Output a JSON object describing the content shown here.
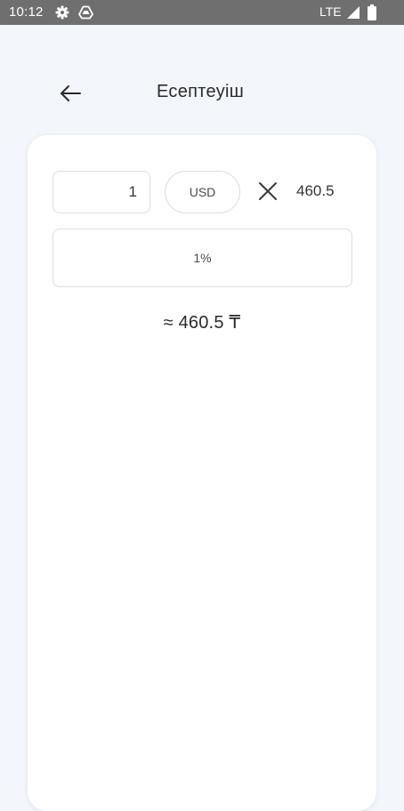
{
  "status_bar": {
    "time": "10:12",
    "network": "LTE",
    "icons": [
      "gear-icon",
      "drive-icon",
      "signal-icon",
      "battery-icon"
    ],
    "background_color": "#6f6f6f"
  },
  "header": {
    "title": "Есептеуіш",
    "back_icon": "arrow-left-icon"
  },
  "calculator": {
    "amount_value": "1",
    "currency_label": "USD",
    "multiply_icon": "close-icon",
    "rate_value": "460.5",
    "percent_label": "1%",
    "result": "≈ 460.5 ₸"
  },
  "colors": {
    "page_background": "#f3f7fc",
    "card_background": "#ffffff",
    "border": "#d9dde2",
    "text": "#2a2a2a"
  }
}
